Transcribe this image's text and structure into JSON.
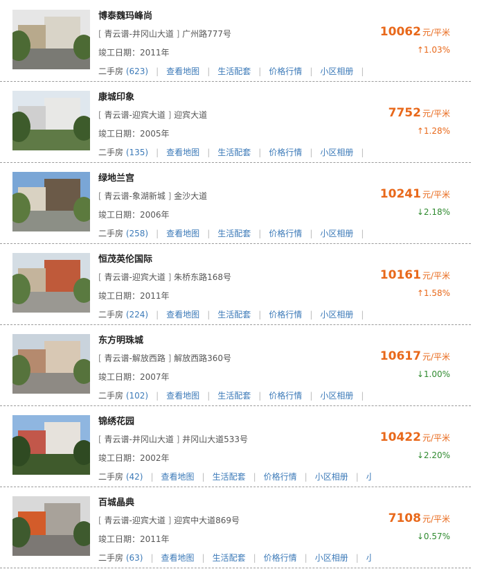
{
  "listings": [
    {
      "name": "博泰魏玛峰尚",
      "district": "青云谱-井冈山大道",
      "street": "广州路777号",
      "completion": "竣工日期：2011年",
      "secondhand_label": "二手房",
      "secondhand_count": "(623)",
      "price": "10062",
      "unit": "元/平米",
      "change_arrow": "↑",
      "change": "1.03%",
      "trend": "up",
      "photo": {
        "sky": "#e6e6e6",
        "ground": "#7a7a74",
        "bld1": "#b8a98c",
        "bld2": "#d9d4c8",
        "tree": "#4c6a34"
      }
    },
    {
      "name": "康城印象",
      "district": "青云谱-迎宾大道",
      "street": "迎宾大道",
      "completion": "竣工日期：2005年",
      "secondhand_label": "二手房",
      "secondhand_count": "(135)",
      "price": "7752",
      "unit": "元/平米",
      "change_arrow": "↑",
      "change": "1.28%",
      "trend": "up",
      "photo": {
        "sky": "#dfe7ee",
        "ground": "#5f7a46",
        "bld1": "#cfcfcf",
        "bld2": "#e8e8e6",
        "tree": "#3d5b2b"
      }
    },
    {
      "name": "绿地兰宫",
      "district": "青云谱-象湖新城",
      "street": "金沙大道",
      "completion": "竣工日期：2006年",
      "secondhand_label": "二手房",
      "secondhand_count": "(258)",
      "price": "10241",
      "unit": "元/平米",
      "change_arrow": "↓",
      "change": "2.18%",
      "trend": "down",
      "photo": {
        "sky": "#7aa6d6",
        "ground": "#8c8f86",
        "bld1": "#d9d2c2",
        "bld2": "#6b5a48",
        "tree": "#5c7a3e"
      }
    },
    {
      "name": "恒茂英伦国际",
      "district": "青云谱-迎宾大道",
      "street": "朱桥东路168号",
      "completion": "竣工日期：2011年",
      "secondhand_label": "二手房",
      "secondhand_count": "(224)",
      "price": "10161",
      "unit": "元/平米",
      "change_arrow": "↑",
      "change": "1.58%",
      "trend": "up",
      "photo": {
        "sky": "#d4dde4",
        "ground": "#9a9892",
        "bld1": "#c4b49c",
        "bld2": "#bf5a3a",
        "tree": "#5a7a40"
      }
    },
    {
      "name": "东方明珠城",
      "district": "青云谱-解放西路",
      "street": "解放西路360号",
      "completion": "竣工日期：2007年",
      "secondhand_label": "二手房",
      "secondhand_count": "(102)",
      "price": "10617",
      "unit": "元/平米",
      "change_arrow": "↓",
      "change": "1.00%",
      "trend": "down",
      "photo": {
        "sky": "#c9d3dc",
        "ground": "#8e8a84",
        "bld1": "#b58a6e",
        "bld2": "#d8c8b4",
        "tree": "#56733c"
      }
    },
    {
      "name": "锦绣花园",
      "district": "青云谱-井冈山大道",
      "street": "井冈山大道533号",
      "completion": "竣工日期：2002年",
      "secondhand_label": "二手房",
      "secondhand_count": "(42)",
      "price": "10422",
      "unit": "元/平米",
      "change_arrow": "↓",
      "change": "2.20%",
      "trend": "down",
      "photo": {
        "sky": "#8fb6e0",
        "ground": "#3f5a2c",
        "bld1": "#c2574a",
        "bld2": "#e6e2dc",
        "tree": "#2f4a22"
      }
    },
    {
      "name": "百城晶典",
      "district": "青云谱-迎宾大道",
      "street": "迎宾中大道869号",
      "completion": "竣工日期：2011年",
      "secondhand_label": "二手房",
      "secondhand_count": "(63)",
      "price": "7108",
      "unit": "元/平米",
      "change_arrow": "↓",
      "change": "0.57%",
      "trend": "down",
      "photo": {
        "sky": "#d9d9d9",
        "ground": "#7c7874",
        "bld1": "#d35c2a",
        "bld2": "#a8a29a",
        "tree": "#3e5a2e"
      }
    }
  ],
  "links": [
    "查看地图",
    "生活配套",
    "价格行情",
    "小区相册",
    "小区"
  ]
}
